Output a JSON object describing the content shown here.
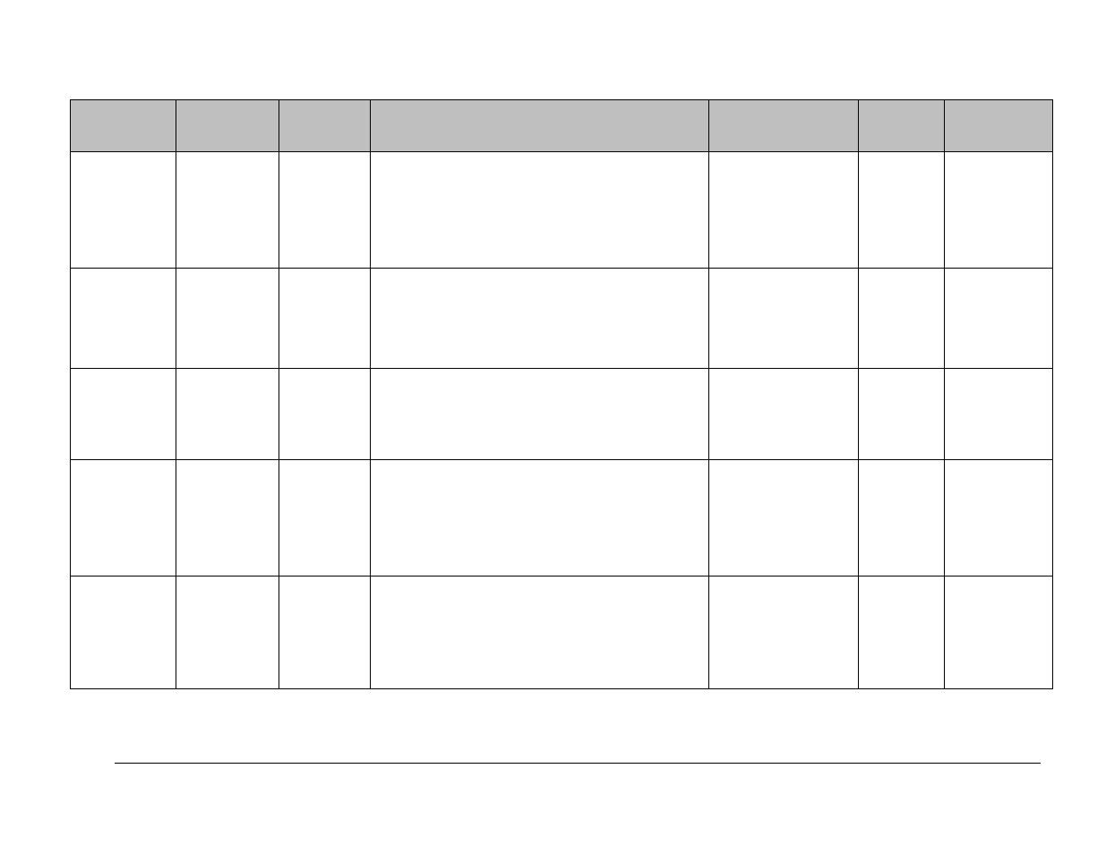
{
  "table": {
    "headers": [
      "",
      "",
      "",
      "",
      "",
      "",
      ""
    ],
    "rows": [
      [
        "",
        "",
        "",
        "",
        "",
        "",
        ""
      ],
      [
        "",
        "",
        "",
        "",
        "",
        "",
        ""
      ],
      [
        "",
        "",
        "",
        "",
        "",
        "",
        ""
      ],
      [
        "",
        "",
        "",
        "",
        "",
        "",
        ""
      ],
      [
        "",
        "",
        "",
        "",
        "",
        "",
        ""
      ]
    ]
  }
}
